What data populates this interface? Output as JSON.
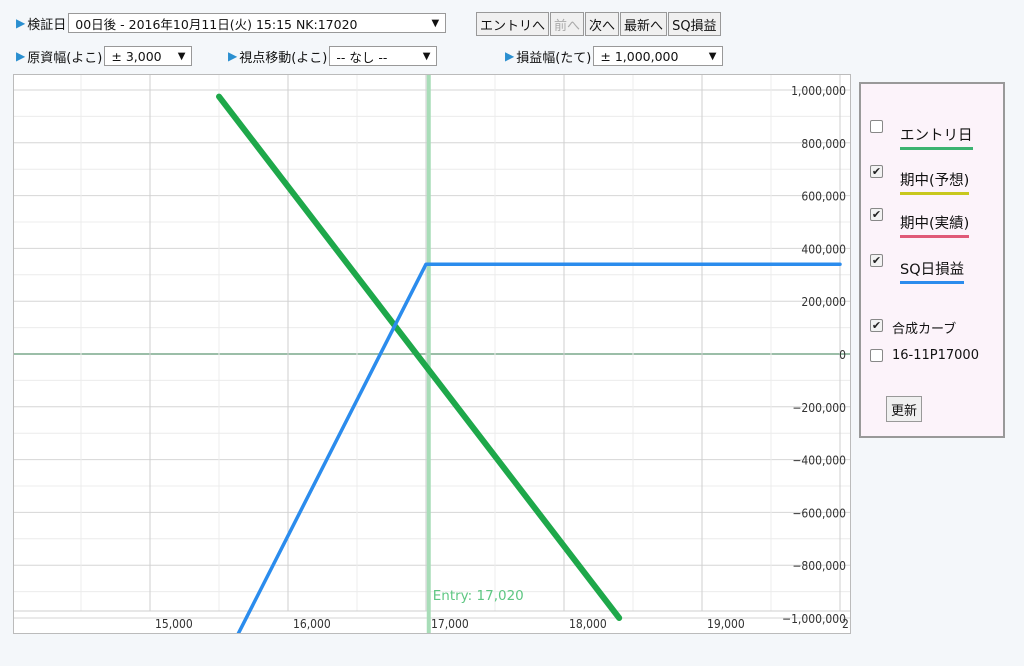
{
  "controls": {
    "verify_date_label": "検証日",
    "verify_date_value": "00日後 - 2016年10月11日(火) 15:15 NK:17020",
    "buttons": {
      "entry": "エントリへ",
      "prev": "前へ",
      "next": "次へ",
      "latest": "最新へ",
      "sq": "SQ損益"
    },
    "underlying_range_label": "原資幅(よこ)",
    "underlying_range_value": "± 3,000",
    "viewpoint_label": "視点移動(よこ)",
    "viewpoint_value": "-- なし --",
    "pl_range_label": "損益幅(たて)",
    "pl_range_value": "± 1,000,000"
  },
  "panel": {
    "entry_day": {
      "label": "エントリ日",
      "checked": false,
      "color": "#3cb371"
    },
    "midterm_forecast": {
      "label": "期中(予想)",
      "checked": true,
      "color": "#c8c81e"
    },
    "midterm_actual": {
      "label": "期中(実績)",
      "checked": true,
      "color": "#e05a78"
    },
    "sq_day_pl": {
      "label": "SQ日損益",
      "checked": true,
      "color": "#2b8ced"
    },
    "combined_curve": {
      "label": "合成カーブ",
      "checked": true
    },
    "position": {
      "label": "16-11P17000",
      "checked": false
    },
    "update_button": "更新"
  },
  "chart_data": {
    "type": "line",
    "x_ticks": [
      "15,000",
      "16,000",
      "17,000",
      "18,000",
      "19,000",
      "2"
    ],
    "y_ticks": [
      "1,000,000",
      "800,000",
      "600,000",
      "400,000",
      "200,000",
      "0",
      "−200,000",
      "−400,000",
      "−600,000",
      "−800,000",
      "−1,000,000"
    ],
    "xlim": [
      14000,
      20000
    ],
    "ylim": [
      -1000000,
      1000000
    ],
    "entry_label": "Entry: 17,020",
    "entry_x": 17020,
    "series": [
      {
        "color": "#1ea84a",
        "values": [
          [
            15500,
            975000
          ],
          [
            18400,
            -1000000
          ]
        ]
      },
      {
        "color": "#2b8ced",
        "values": [
          [
            15600,
            -1100000
          ],
          [
            17000,
            340000
          ],
          [
            20000,
            340000
          ]
        ]
      }
    ]
  }
}
